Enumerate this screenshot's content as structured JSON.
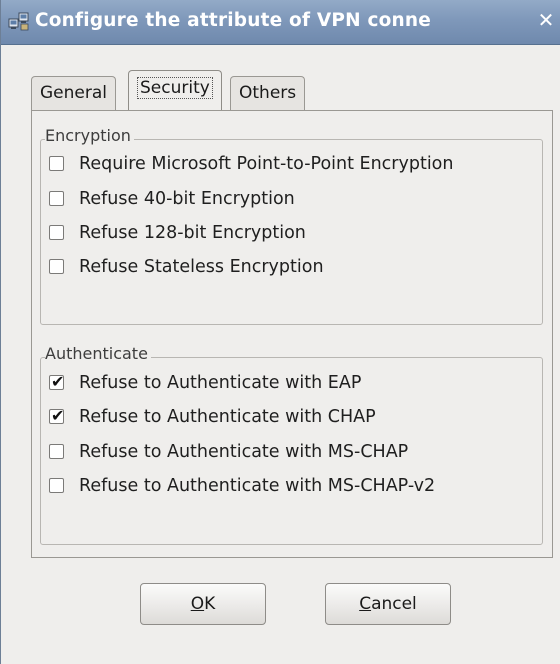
{
  "window": {
    "title": "Configure the attribute of VPN conne",
    "title_icon": "network-connection-icon",
    "close_glyph": "✕"
  },
  "tabs": [
    {
      "label": "General",
      "active": false
    },
    {
      "label": "Security",
      "active": true
    },
    {
      "label": "Others",
      "active": false
    }
  ],
  "encryption": {
    "label": "Encryption",
    "items": [
      {
        "label": "Require Microsoft Point-to-Point Encryption",
        "checked": false
      },
      {
        "label": "Refuse 40-bit Encryption",
        "checked": false
      },
      {
        "label": "Refuse 128-bit Encryption",
        "checked": false
      },
      {
        "label": "Refuse Stateless Encryption",
        "checked": false
      }
    ]
  },
  "authenticate": {
    "label": "Authenticate",
    "items": [
      {
        "label": "Refuse to Authenticate with EAP",
        "checked": true
      },
      {
        "label": "Refuse to Authenticate with CHAP",
        "checked": true
      },
      {
        "label": "Refuse to Authenticate with MS-CHAP",
        "checked": false
      },
      {
        "label": "Refuse to Authenticate with MS-CHAP-v2",
        "checked": false
      }
    ]
  },
  "buttons": {
    "ok": {
      "mnemonic": "O",
      "rest": "K"
    },
    "cancel": {
      "mnemonic": "C",
      "rest": "ancel"
    }
  },
  "colors": {
    "titlebar": "#7f98ba",
    "window_bg": "#efeeec"
  }
}
